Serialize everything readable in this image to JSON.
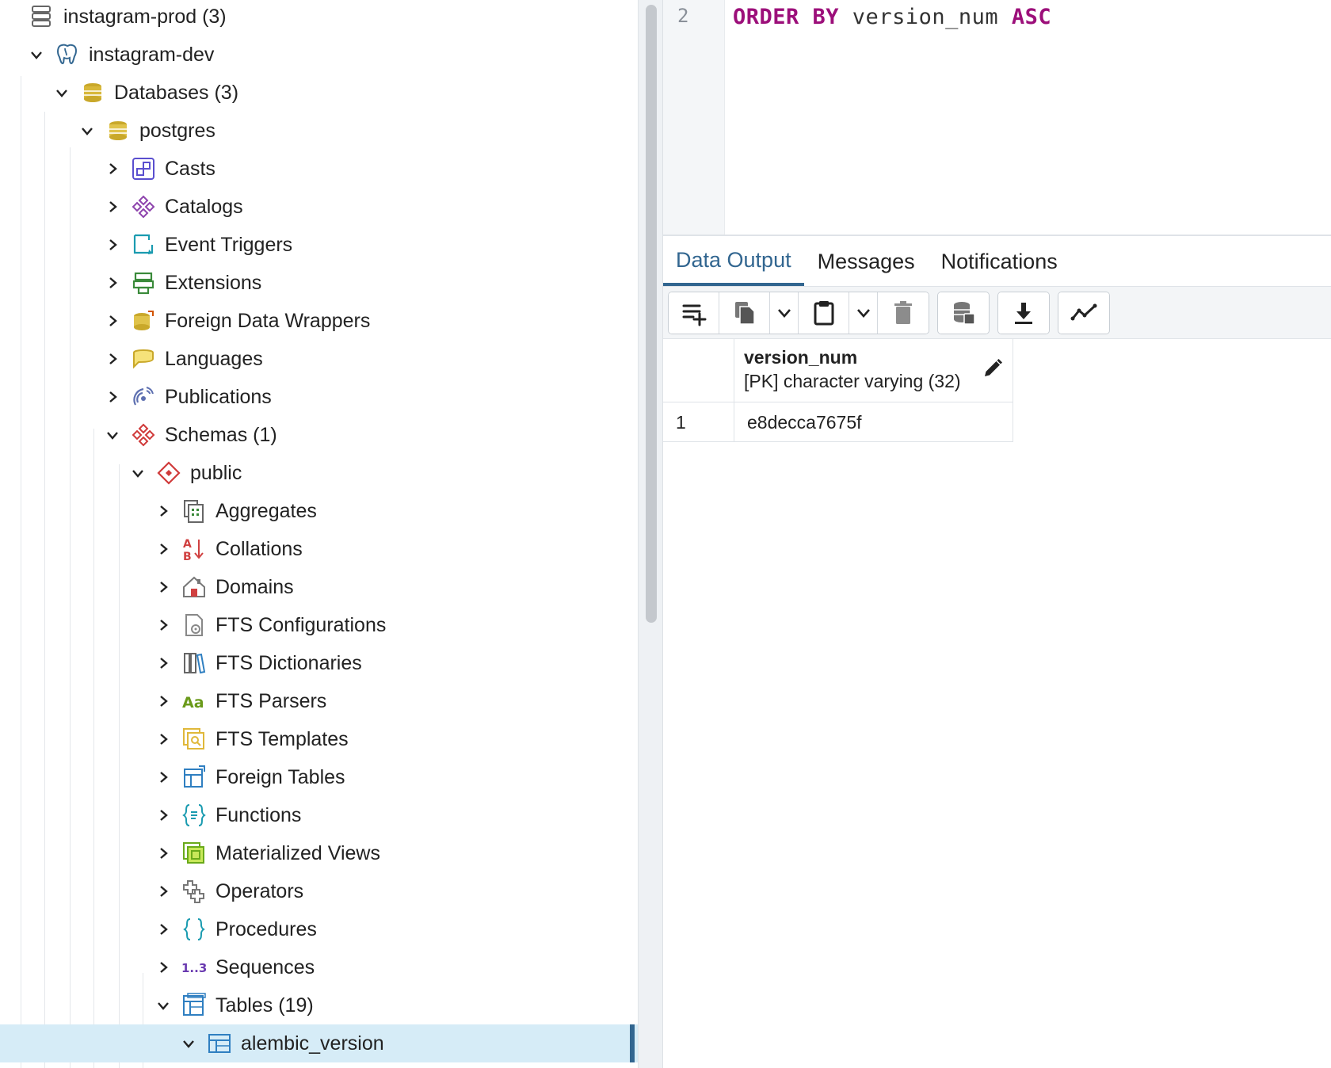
{
  "tree": {
    "items": [
      {
        "label": "instagram-prod (3)",
        "icon": "server-group-icon",
        "chevron": "none"
      },
      {
        "label": "instagram-dev",
        "icon": "postgres-elephant-icon",
        "chevron": "down"
      },
      {
        "label": "Databases (3)",
        "icon": "databases-icon",
        "chevron": "down"
      },
      {
        "label": "postgres",
        "icon": "database-icon",
        "chevron": "down"
      },
      {
        "label": "Casts",
        "icon": "casts-icon",
        "chevron": "right"
      },
      {
        "label": "Catalogs",
        "icon": "catalogs-icon",
        "chevron": "right"
      },
      {
        "label": "Event Triggers",
        "icon": "event-triggers-icon",
        "chevron": "right"
      },
      {
        "label": "Extensions",
        "icon": "extensions-icon",
        "chevron": "right"
      },
      {
        "label": "Foreign Data Wrappers",
        "icon": "foreign-data-wrappers-icon",
        "chevron": "right"
      },
      {
        "label": "Languages",
        "icon": "languages-icon",
        "chevron": "right"
      },
      {
        "label": "Publications",
        "icon": "publications-icon",
        "chevron": "right"
      },
      {
        "label": "Schemas (1)",
        "icon": "schemas-icon",
        "chevron": "down"
      },
      {
        "label": "public",
        "icon": "schema-icon",
        "chevron": "down"
      },
      {
        "label": "Aggregates",
        "icon": "aggregates-icon",
        "chevron": "right"
      },
      {
        "label": "Collations",
        "icon": "collations-icon",
        "chevron": "right"
      },
      {
        "label": "Domains",
        "icon": "domains-icon",
        "chevron": "right"
      },
      {
        "label": "FTS Configurations",
        "icon": "fts-configurations-icon",
        "chevron": "right"
      },
      {
        "label": "FTS Dictionaries",
        "icon": "fts-dictionaries-icon",
        "chevron": "right"
      },
      {
        "label": "FTS Parsers",
        "icon": "fts-parsers-icon",
        "chevron": "right"
      },
      {
        "label": "FTS Templates",
        "icon": "fts-templates-icon",
        "chevron": "right"
      },
      {
        "label": "Foreign Tables",
        "icon": "foreign-tables-icon",
        "chevron": "right"
      },
      {
        "label": "Functions",
        "icon": "functions-icon",
        "chevron": "right"
      },
      {
        "label": "Materialized Views",
        "icon": "materialized-views-icon",
        "chevron": "right"
      },
      {
        "label": "Operators",
        "icon": "operators-icon",
        "chevron": "right"
      },
      {
        "label": "Procedures",
        "icon": "procedures-icon",
        "chevron": "right"
      },
      {
        "label": "Sequences",
        "icon": "sequences-icon",
        "chevron": "right"
      },
      {
        "label": "Tables (19)",
        "icon": "tables-icon",
        "chevron": "down"
      },
      {
        "label": "alembic_version",
        "icon": "table-icon",
        "chevron": "down",
        "selected": true
      }
    ]
  },
  "editor": {
    "line_number": "2",
    "keyword1": "ORDER BY",
    "identifier": " version_num ",
    "keyword2": "ASC"
  },
  "tabs": [
    {
      "label": "Data Output",
      "active": true
    },
    {
      "label": "Messages",
      "active": false
    },
    {
      "label": "Notifications",
      "active": false
    }
  ],
  "toolbar": {
    "buttons": [
      "add-row-icon",
      "copy-icon",
      "chevron-down-icon",
      "paste-icon",
      "chevron-down-icon",
      "delete-icon",
      "save-data-icon",
      "download-icon",
      "graph-icon"
    ]
  },
  "grid": {
    "column": {
      "name": "version_num",
      "type": "[PK] character varying (32)"
    },
    "rows": [
      {
        "num": "1",
        "value": "e8decca7675f"
      }
    ]
  },
  "colors": {
    "accent": "#326690",
    "selected_row": "#d6ecf7",
    "keyword": "#9c0f7a"
  }
}
